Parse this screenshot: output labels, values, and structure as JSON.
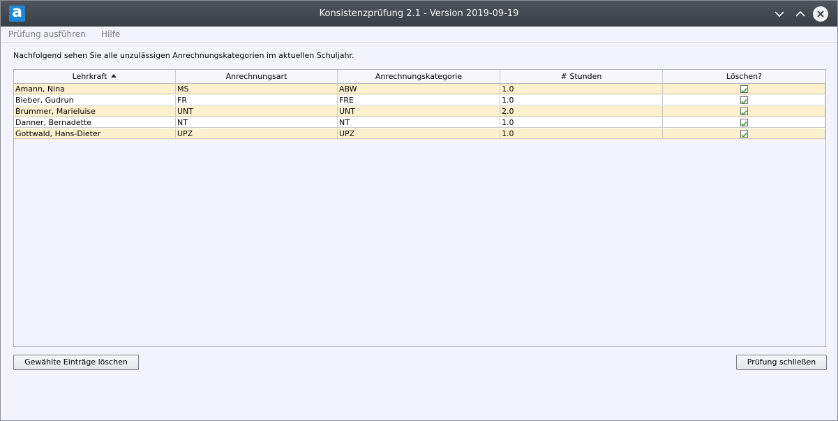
{
  "window": {
    "title": "Konsistenzprüfung 2.1 - Version 2019-09-19",
    "app_icon_letter": "a"
  },
  "menu": {
    "items": [
      "Prüfung ausführen",
      "Hilfe"
    ]
  },
  "info_text": "Nachfolgend sehen Sie alle unzulässigen Anrechnungskategorien im aktuellen Schuljahr.",
  "table": {
    "columns": [
      "Lehrkraft",
      "Anrechnungsart",
      "Anrechnungskategorie",
      "# Stunden",
      "Löschen?"
    ],
    "sort_column": "Lehrkraft",
    "sort_direction": "ascending",
    "rows": [
      {
        "lehrkraft": "Amann, Nina",
        "art": "MS",
        "kategorie": "ABW",
        "stunden": "1.0",
        "loeschen": true
      },
      {
        "lehrkraft": "Bieber, Gudrun",
        "art": "FR",
        "kategorie": "FRE",
        "stunden": "1.0",
        "loeschen": true
      },
      {
        "lehrkraft": "Brummer, Marieluise",
        "art": "UNT",
        "kategorie": "UNT",
        "stunden": "2.0",
        "loeschen": true
      },
      {
        "lehrkraft": "Danner, Bernadette",
        "art": "NT",
        "kategorie": "NT",
        "stunden": "1.0",
        "loeschen": true
      },
      {
        "lehrkraft": "Gottwald, Hans-Dieter",
        "art": "UPZ",
        "kategorie": "UPZ",
        "stunden": "1.0",
        "loeschen": true
      }
    ]
  },
  "buttons": {
    "delete_selected": "Gewählte Einträge löschen",
    "close_check": "Prüfung schließen"
  },
  "colors": {
    "titlebar": "#3f444a",
    "row_odd": "#fdf0cc",
    "row_even": "#ffffff",
    "check_green": "#2e9e2e",
    "app_icon": "#1e88d7"
  }
}
